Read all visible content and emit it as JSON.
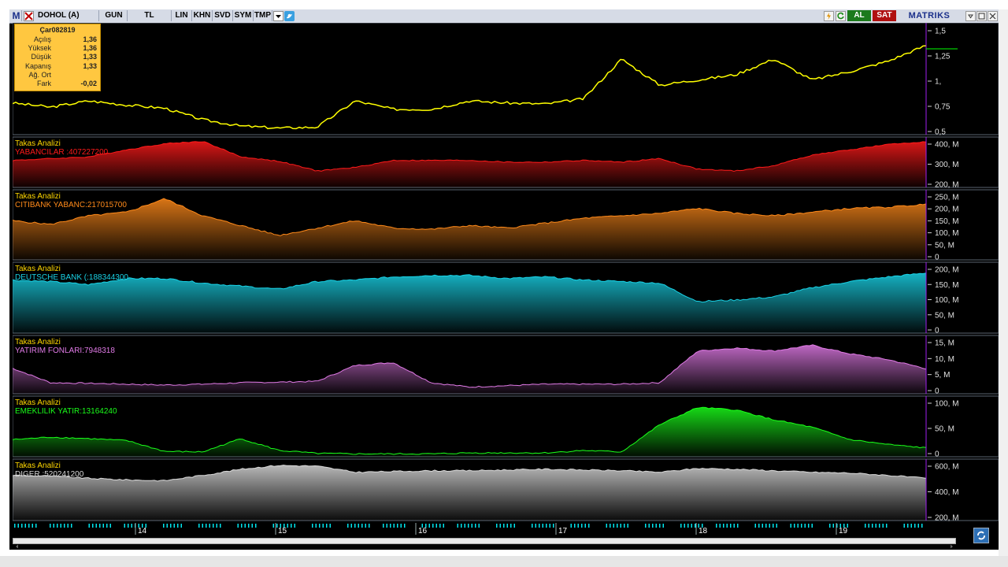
{
  "toolbar": {
    "logo": "M",
    "symbol": "DOHOL (A)",
    "period": "GUN",
    "currency": "TL",
    "scale": "LIN",
    "buttons": [
      "KHN",
      "SVD",
      "SYM",
      "TMP"
    ],
    "buy": "AL",
    "sell": "SAT",
    "brand": "MATRIKS"
  },
  "info": {
    "date": "Çar082819",
    "rows": [
      {
        "label": "Açılış",
        "value": "1,36"
      },
      {
        "label": "Yüksek",
        "value": "1,36"
      },
      {
        "label": "Düşük",
        "value": "1,33"
      },
      {
        "label": "Kapanış",
        "value": "1,33"
      },
      {
        "label": "Ağ. Ort",
        "value": ""
      },
      {
        "label": "Fark",
        "value": "-0,02"
      }
    ]
  },
  "colors": {
    "price": "#ffff00",
    "yabancilar": "#ff1a1a",
    "citibank": "#ff8a1a",
    "deutsche": "#19d2e6",
    "yatirim": "#e07ae6",
    "emeklilik": "#1aff1a",
    "diger": "#d9d9d9",
    "axis_tick": "#00e5ee"
  },
  "panels": [
    {
      "id": "price",
      "title": "",
      "series_label": "",
      "ticks": [
        "1,5",
        "1,25",
        "1,",
        "0,75",
        "0,5"
      ]
    },
    {
      "id": "yabancilar",
      "title": "Takas Analizi",
      "series_label": "YABANCILAR   :407227200",
      "ticks": [
        "400, M",
        "300, M",
        "200, M"
      ]
    },
    {
      "id": "citibank",
      "title": "Takas Analizi",
      "series_label": "CITIBANK YABANC:217015700",
      "ticks": [
        "250, M",
        "200, M",
        "150, M",
        "100, M",
        "50, M",
        "0"
      ]
    },
    {
      "id": "deutsche",
      "title": "Takas Analizi",
      "series_label": "DEUTSCHE BANK (:188344300",
      "ticks": [
        "200, M",
        "150, M",
        "100, M",
        "50, M",
        "0"
      ]
    },
    {
      "id": "yatirim",
      "title": "Takas Analizi",
      "series_label": "YATIRIM FONLARI:7948318",
      "ticks": [
        "15, M",
        "10, M",
        "5, M",
        "0"
      ]
    },
    {
      "id": "emeklilik",
      "title": "Takas Analizi",
      "series_label": "EMEKLILIK YATIR:13164240",
      "ticks": [
        "100, M",
        "50, M",
        "0"
      ]
    },
    {
      "id": "diger",
      "title": "Takas Analizi",
      "series_label": "DIGER        :520241200",
      "ticks": [
        "600, M",
        "400, M",
        "200, M"
      ]
    }
  ],
  "x_axis": {
    "labels": [
      "14",
      "15",
      "16",
      "17",
      "18",
      "19"
    ]
  },
  "chart_data": {
    "type": "line",
    "x_labels": [
      "14",
      "15",
      "16",
      "17",
      "18",
      "19"
    ],
    "series": [
      {
        "name": "DOHOL (A)",
        "ylim": [
          0.5,
          1.5
        ],
        "values": [
          0.78,
          0.74,
          0.8,
          0.76,
          0.73,
          0.62,
          0.56,
          0.54,
          0.55,
          0.8,
          0.72,
          0.72,
          0.8,
          0.78,
          0.77,
          0.82,
          1.2,
          0.95,
          1.0,
          1.05,
          1.2,
          1.0,
          1.08,
          1.18,
          1.33
        ]
      },
      {
        "name": "YABANCILAR",
        "ylim": [
          160,
          410
        ],
        "values": [
          300,
          310,
          320,
          360,
          395,
          408,
          320,
          295,
          240,
          260,
          300,
          300,
          300,
          290,
          290,
          300,
          290,
          310,
          250,
          240,
          270,
          330,
          360,
          390,
          407
        ]
      },
      {
        "name": "CITIBANK YABANC",
        "ylim": [
          0,
          260
        ],
        "values": [
          150,
          135,
          170,
          185,
          240,
          170,
          130,
          90,
          120,
          150,
          120,
          115,
          130,
          120,
          140,
          160,
          170,
          180,
          200,
          180,
          170,
          185,
          200,
          205,
          217
        ]
      },
      {
        "name": "DEUTSCHE BANK (",
        "ylim": [
          0,
          210
        ],
        "values": [
          165,
          160,
          150,
          170,
          170,
          155,
          145,
          135,
          160,
          165,
          175,
          180,
          180,
          170,
          175,
          165,
          160,
          155,
          95,
          100,
          110,
          140,
          160,
          175,
          188
        ]
      },
      {
        "name": "YATIRIM FONLARI",
        "ylim": [
          0,
          18
        ],
        "values": [
          8,
          3,
          2.8,
          2.5,
          2.2,
          2.5,
          3,
          3.2,
          3.5,
          9,
          10,
          3,
          1.5,
          2,
          2.5,
          2.5,
          2.5,
          3,
          14,
          15,
          14,
          16,
          13,
          11,
          7.9
        ]
      },
      {
        "name": "EMEKLILIK YATIR",
        "ylim": [
          0,
          110
        ],
        "values": [
          30,
          35,
          32,
          28,
          6,
          5,
          32,
          8,
          2,
          1,
          1,
          1,
          3,
          3,
          3,
          8,
          5,
          60,
          95,
          90,
          70,
          55,
          30,
          20,
          13
        ]
      },
      {
        "name": "DIGER",
        "ylim": [
          0,
          720
        ],
        "values": [
          560,
          550,
          520,
          500,
          490,
          560,
          640,
          690,
          680,
          600,
          610,
          620,
          620,
          630,
          640,
          630,
          620,
          600,
          650,
          640,
          620,
          600,
          590,
          560,
          520
        ]
      }
    ]
  }
}
